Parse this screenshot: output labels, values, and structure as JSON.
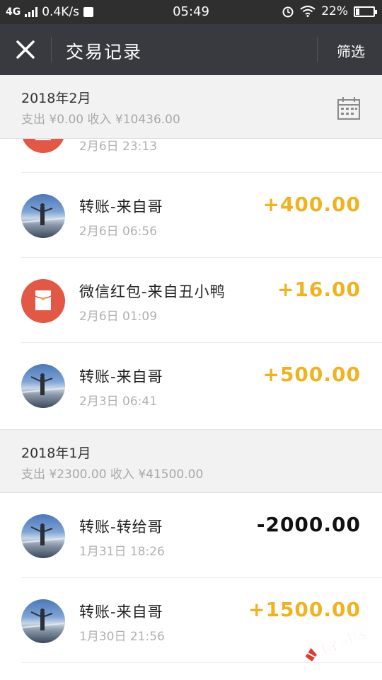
{
  "status_bar": {
    "network": "4G",
    "speed": "0.4K/s",
    "time": "05:49",
    "battery_percent": "22%",
    "battery_level": 0.22
  },
  "nav": {
    "title": "交易记录",
    "filter_label": "筛选"
  },
  "months": [
    {
      "title": "2018年2月",
      "summary": "支出 ¥0.00 收入 ¥10436.00",
      "transactions": [
        {
          "title": "",
          "time": "2月6日 23:13",
          "amount": "",
          "avatar": "red-packet-icon"
        },
        {
          "title": "转账-来自哥",
          "time": "2月6日 06:56",
          "amount": "+400.00",
          "avatar": "photo"
        },
        {
          "title": "微信红包-来自丑小鸭",
          "time": "2月6日 01:09",
          "amount": "+16.00",
          "avatar": "red-packet-icon"
        },
        {
          "title": "转账-来自哥",
          "time": "2月3日 06:41",
          "amount": "+500.00",
          "avatar": "photo"
        }
      ]
    },
    {
      "title": "2018年1月",
      "summary": "支出 ¥2300.00 收入 ¥41500.00",
      "transactions": [
        {
          "title": "转账-转给哥",
          "time": "1月31日 18:26",
          "amount": "-2000.00",
          "avatar": "photo"
        },
        {
          "title": "转账-来自哥",
          "time": "1月30日 21:56",
          "amount": "+1500.00",
          "avatar": "photo"
        }
      ]
    }
  ],
  "colors": {
    "nav_bg": "#393a3f",
    "income": "#f0b21e",
    "expense": "#111111",
    "red_packet": "#e35745"
  },
  "watermark": {
    "text": "卡农社区"
  }
}
